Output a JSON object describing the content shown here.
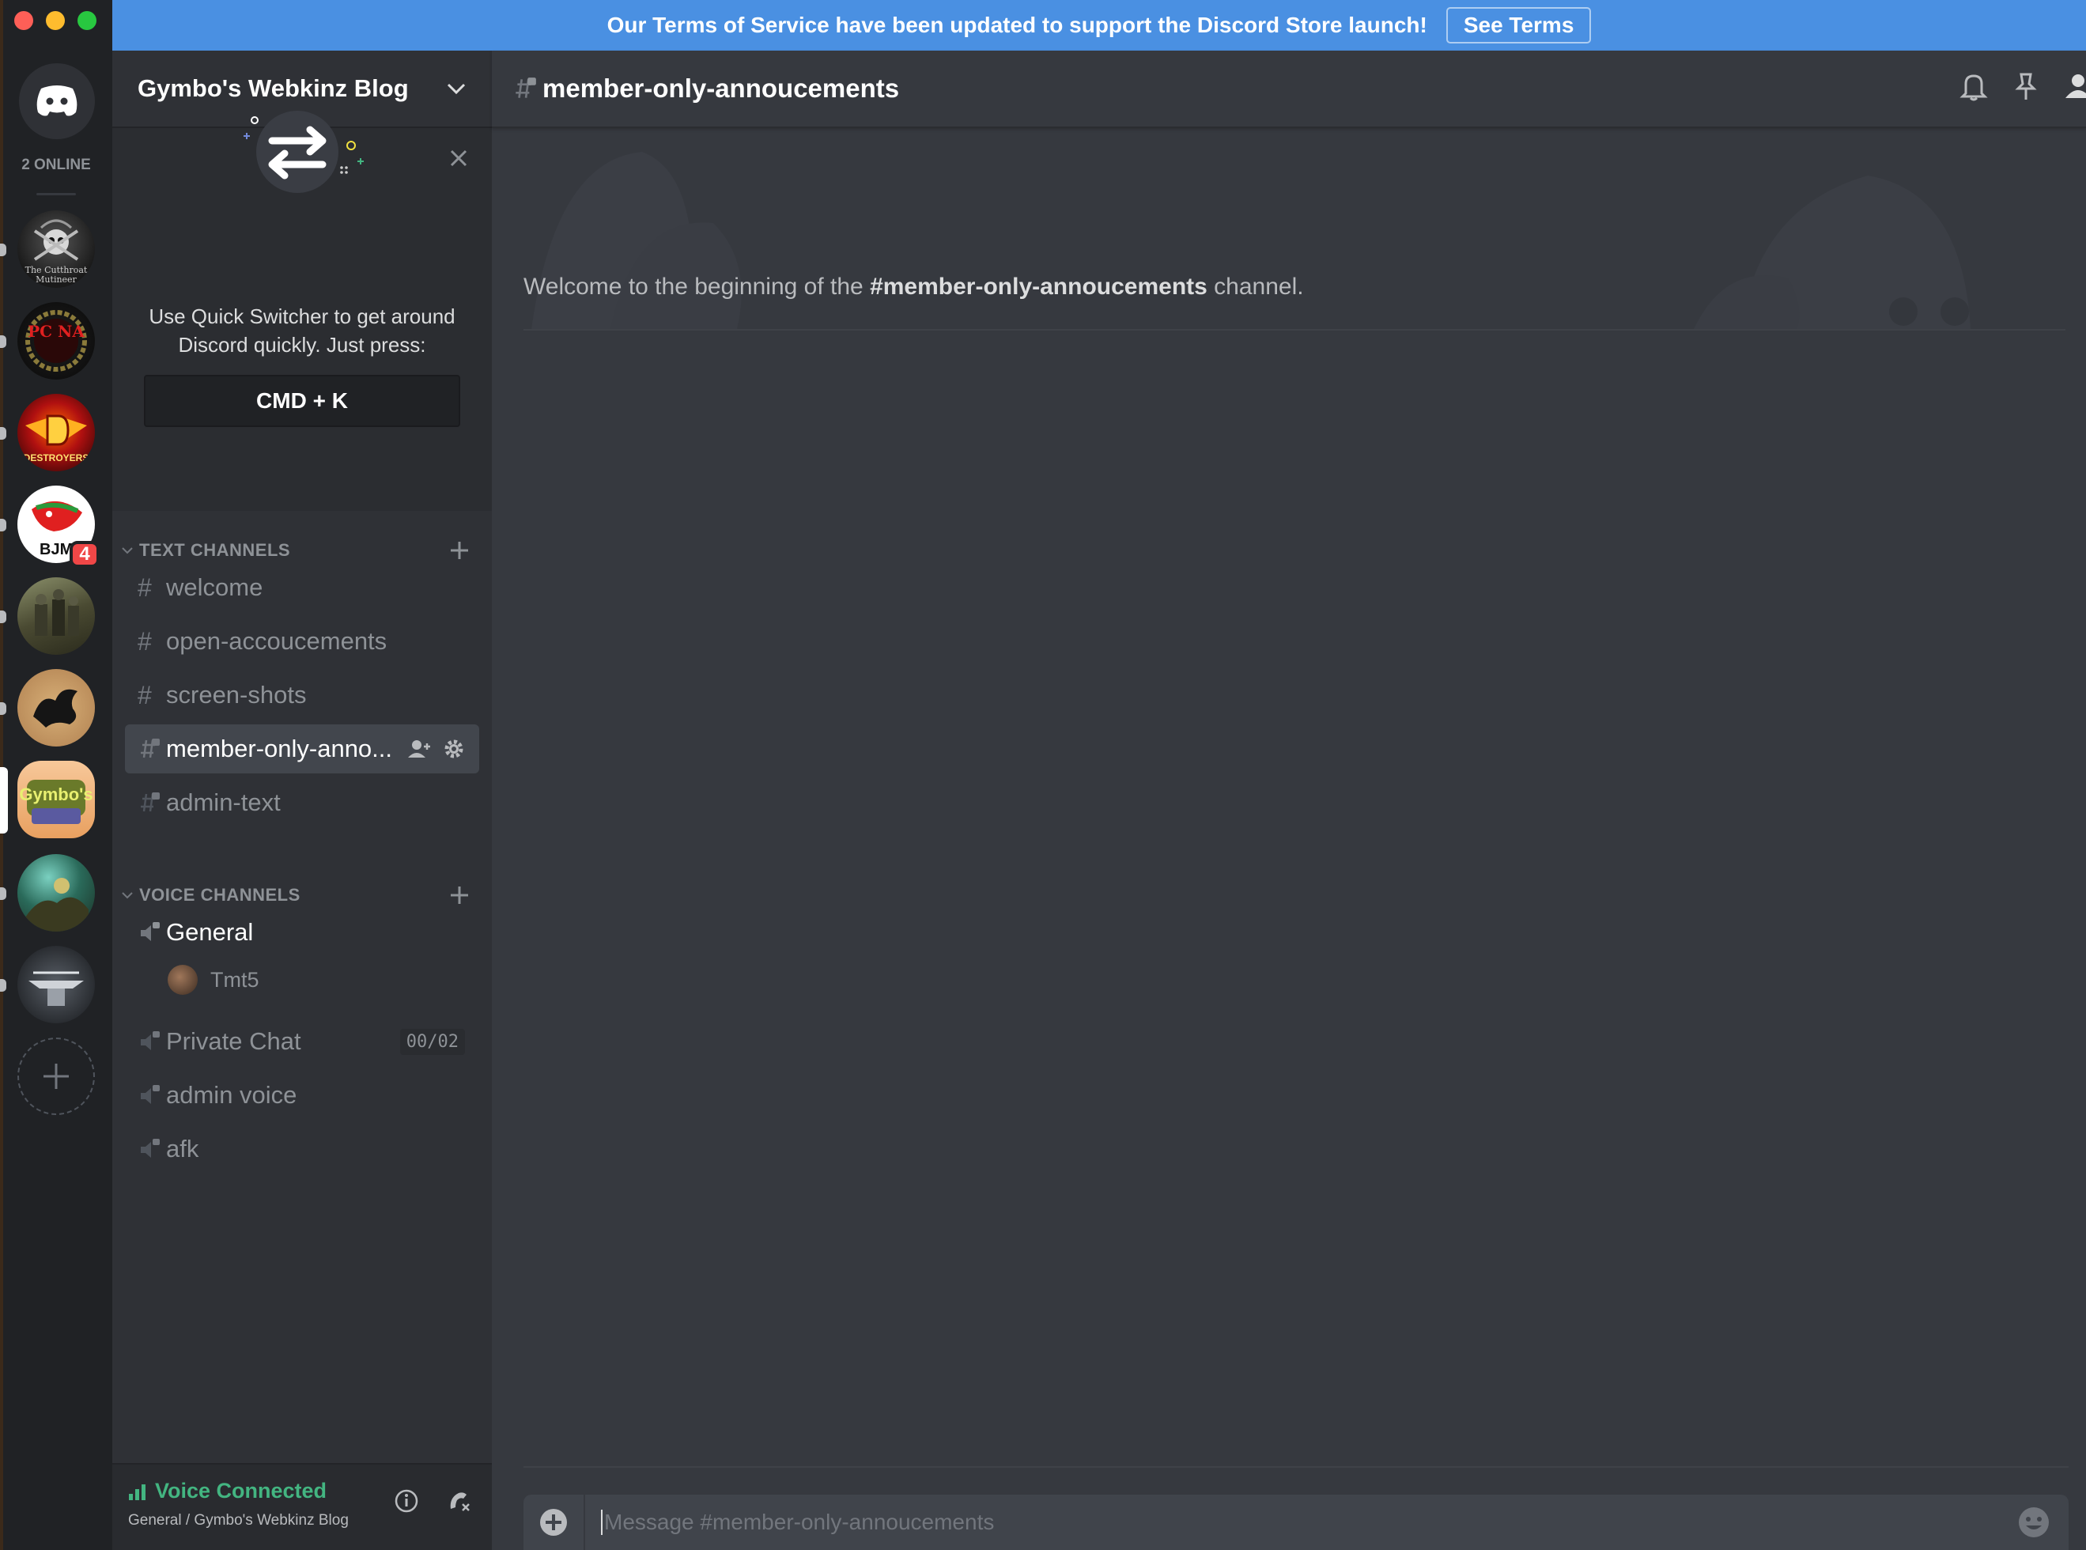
{
  "banner": {
    "text": "Our Terms of Service have been updated to support the Discord Store launch!",
    "button": "See Terms"
  },
  "rail": {
    "online_label": "2 ONLINE",
    "servers": [
      {
        "name": "The Cutthroat Mutineers",
        "icon": "pirate-skull-icon",
        "label": "The Cutthroat Mutineer"
      },
      {
        "name": "PCNA",
        "icon": "wreath-emblem-icon",
        "label": "PC NA"
      },
      {
        "name": "Destroyers",
        "icon": "winged-d-emblem-icon",
        "label": "DESTROYERS"
      },
      {
        "name": "BJM",
        "icon": "red-bird-icon",
        "label": "BJM",
        "badge": "4"
      },
      {
        "name": "Warriors",
        "icon": "armored-warriors-icon"
      },
      {
        "name": "Dragon",
        "icon": "dragon-silhouette-icon"
      },
      {
        "name": "Gymbo's Webkinz Blog",
        "icon": "gymbos-logo-icon",
        "label": "Gymbo's",
        "active": true
      },
      {
        "name": "Fantasy",
        "icon": "fantasy-scene-icon"
      },
      {
        "name": "Gear",
        "icon": "mech-emblem-icon"
      }
    ],
    "add_server_icon": "plus-icon"
  },
  "sidebar": {
    "guild_name": "Gymbo's Webkinz Blog",
    "tip": {
      "text": "Use Quick Switcher to get around Discord quickly. Just press:",
      "shortcut": "CMD + K"
    },
    "text_category": "TEXT CHANNELS",
    "text_channels": [
      {
        "name": "welcome",
        "locked": false
      },
      {
        "name": "open-accoucements",
        "locked": false
      },
      {
        "name": "screen-shots",
        "locked": false
      },
      {
        "name": "member-only-anno...",
        "locked": true,
        "active": true
      },
      {
        "name": "admin-text",
        "locked": true
      }
    ],
    "voice_category": "VOICE CHANNELS",
    "voice_channels": [
      {
        "name": "General"
      },
      {
        "name": "Private Chat",
        "limit": "00/02"
      },
      {
        "name": "admin voice"
      },
      {
        "name": "afk"
      }
    ],
    "voice_user": "Tmt5",
    "voice_panel": {
      "status": "Voice Connected",
      "sub": "General / Gymbo's Webkinz Blog"
    }
  },
  "chat": {
    "channel": "member-only-annoucements",
    "welcome_prefix": "Welcome to the beginning of the ",
    "welcome_channel": "#member-only-annoucements",
    "welcome_suffix": " channel.",
    "placeholder": "Message #member-only-annoucements"
  },
  "colors": {
    "banner": "#4a90e2",
    "rail": "#202225",
    "sidebar": "#2f3136",
    "main": "#36393f",
    "voice_green": "#43b581",
    "badge_red": "#f04747"
  }
}
